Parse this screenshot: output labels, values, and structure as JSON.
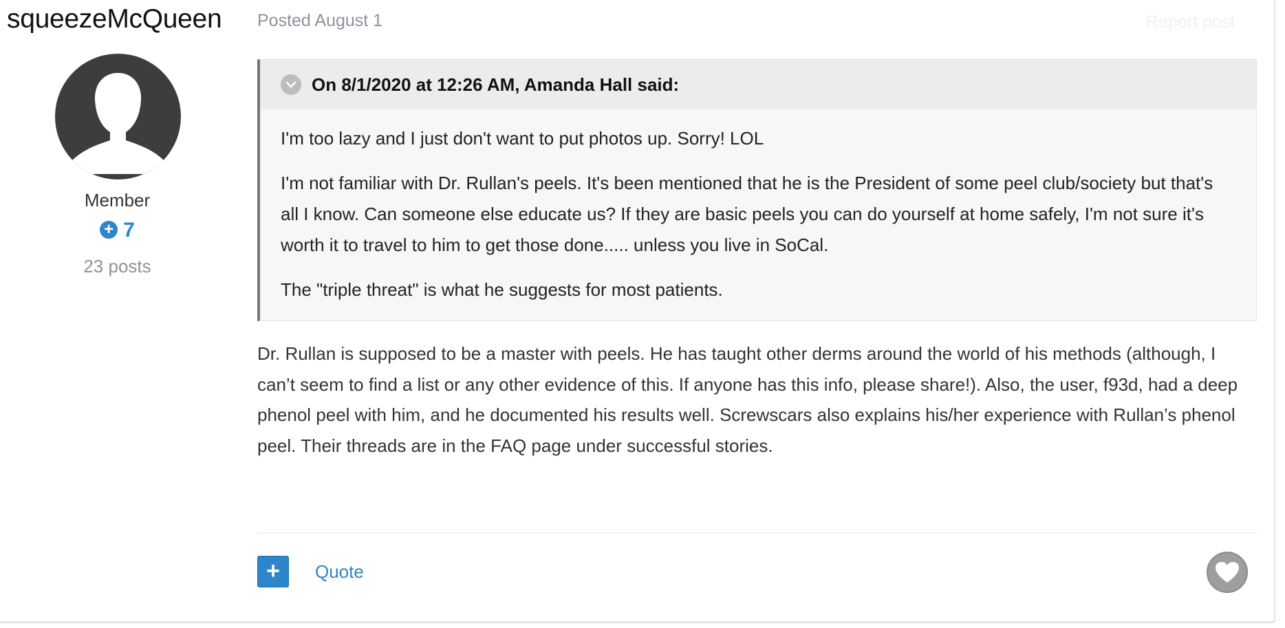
{
  "author": {
    "name": "squeezeMcQueen",
    "rank": "Member",
    "reputation": "7",
    "post_count": "23 posts"
  },
  "post": {
    "date": "Posted August 1",
    "report_label": "Report post",
    "quote": {
      "citation": "On 8/1/2020 at 12:26 AM, Amanda Hall said:",
      "paragraphs": [
        "I'm too lazy and I just don't want to put photos up. Sorry! LOL",
        "I'm not familiar with Dr. Rullan's peels. It's been mentioned that he is the President of some peel club/society but that's all I know. Can someone else educate us? If they are basic peels you can do yourself at home safely, I'm not sure it's worth it to travel to him to get those done..... unless you live in SoCal.",
        "The \"triple threat\" is what he suggests for most patients."
      ]
    },
    "content": "Dr. Rullan is supposed to be a master with peels. He has taught other derms around the world of his methods (although, I can’t seem to find a list or any other evidence of this. If anyone has this info, please share!). Also, the user, f93d, had a deep phenol peel with him, and he documented his results well. Screwscars also explains his/her experience with Rullan’s phenol peel. Their threads are in the FAQ page under successful stories.",
    "multiquote_symbol": "+",
    "quote_label": "Quote"
  },
  "colors": {
    "accent": "#2c86c9",
    "avatar": "#3d3d3d",
    "quote_border": "#757575",
    "muted_text": "#8a939c"
  },
  "icons": {
    "quote_toggle": "chevron-down-icon",
    "reputation": "plus-circle-icon",
    "like": "heart-icon",
    "avatar": "default-user-silhouette-icon"
  }
}
